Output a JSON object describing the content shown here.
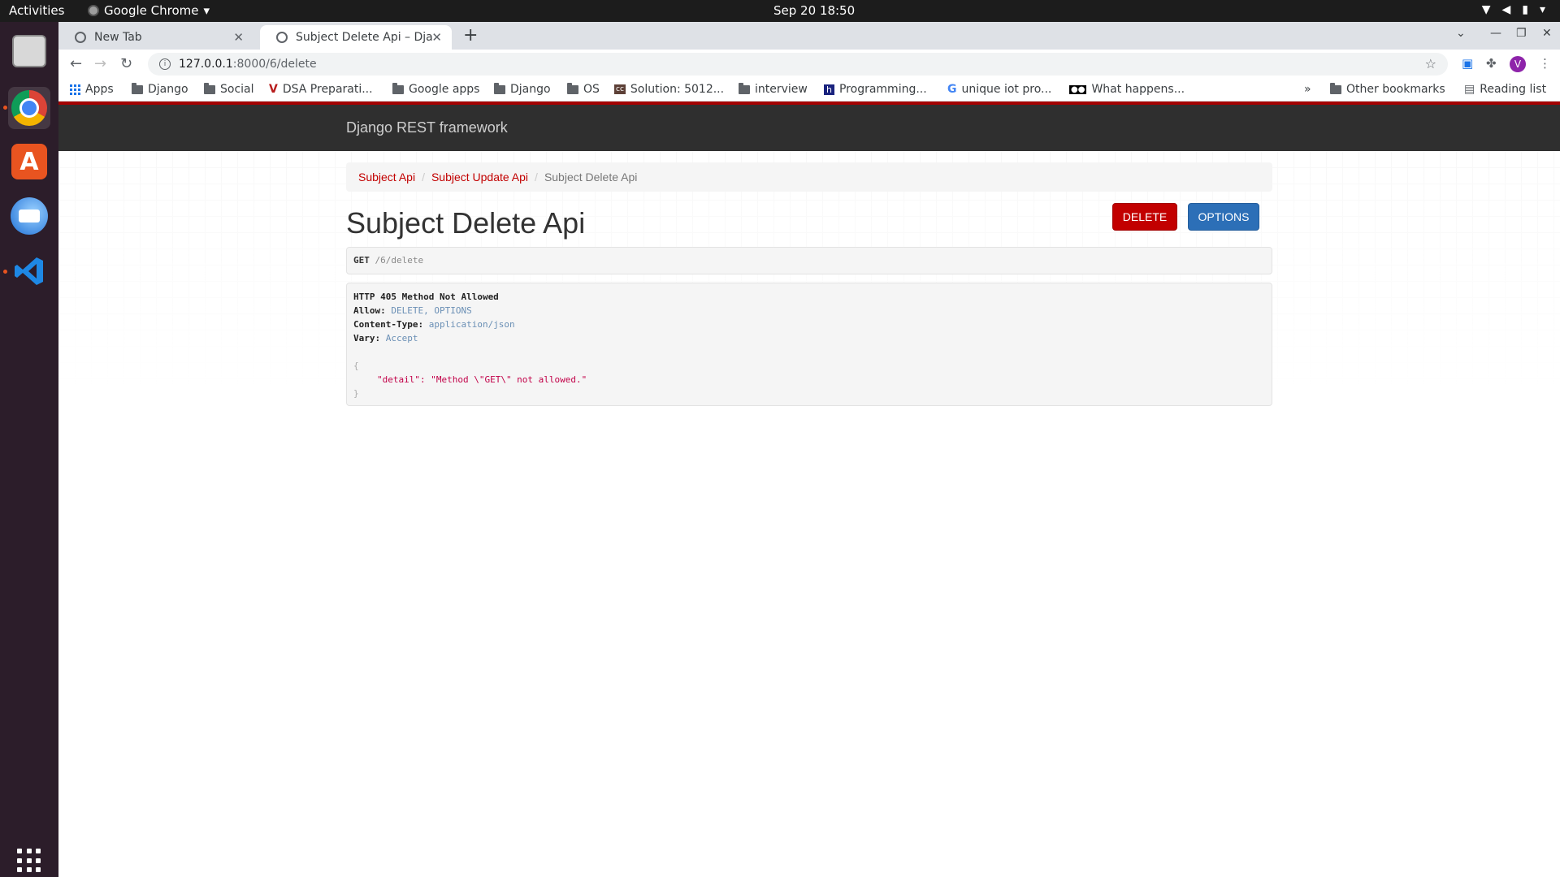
{
  "system": {
    "activities": "Activities",
    "app_name": "Google Chrome",
    "clock": "Sep 20  18:50"
  },
  "browser": {
    "tabs": [
      {
        "title": "New Tab",
        "active": false
      },
      {
        "title": "Subject Delete Api – Djan",
        "active": true
      }
    ],
    "url_host": "127.0.0.1",
    "url_path": ":8000/6/delete",
    "avatar_letter": "V",
    "bookmarks": [
      {
        "label": "Apps",
        "icon": "apps-grid-icon"
      },
      {
        "label": "Django",
        "icon": "folder-icon"
      },
      {
        "label": "Social",
        "icon": "folder-icon"
      },
      {
        "label": "DSA Preparati...",
        "icon": "bookmark-v-icon"
      },
      {
        "label": "Google apps",
        "icon": "folder-icon"
      },
      {
        "label": "Django",
        "icon": "folder-icon"
      },
      {
        "label": "OS",
        "icon": "folder-icon"
      },
      {
        "label": "Solution: 5012...",
        "icon": "bookmark-cc-icon"
      },
      {
        "label": "interview",
        "icon": "folder-icon"
      },
      {
        "label": "Programming...",
        "icon": "bookmark-h-icon"
      },
      {
        "label": "unique iot pro...",
        "icon": "google-icon"
      },
      {
        "label": "What happens...",
        "icon": "bookmark-medium-icon"
      }
    ],
    "other_bookmarks": "Other bookmarks",
    "reading_list": "Reading list"
  },
  "page": {
    "brand": "Django REST framework",
    "breadcrumb": [
      "Subject Api",
      "Subject Update Api",
      "Subject Delete Api"
    ],
    "title": "Subject Delete Api",
    "buttons": {
      "delete": "DELETE",
      "options": "OPTIONS"
    },
    "request": {
      "method": "GET",
      "path": "/6/delete"
    },
    "response": {
      "status": "HTTP 405 Method Not Allowed",
      "headers": [
        {
          "key": "Allow:",
          "value": "DELETE, OPTIONS"
        },
        {
          "key": "Content-Type:",
          "value": "application/json"
        },
        {
          "key": "Vary:",
          "value": "Accept"
        }
      ],
      "open_brace": "{",
      "body_line": "\"detail\": \"Method \\\"GET\\\" not allowed.\"",
      "close_brace": "}"
    }
  },
  "colors": {
    "drf_red": "#c20000",
    "options_blue": "#2c6fb7",
    "navbar": "#2f2f2f"
  }
}
